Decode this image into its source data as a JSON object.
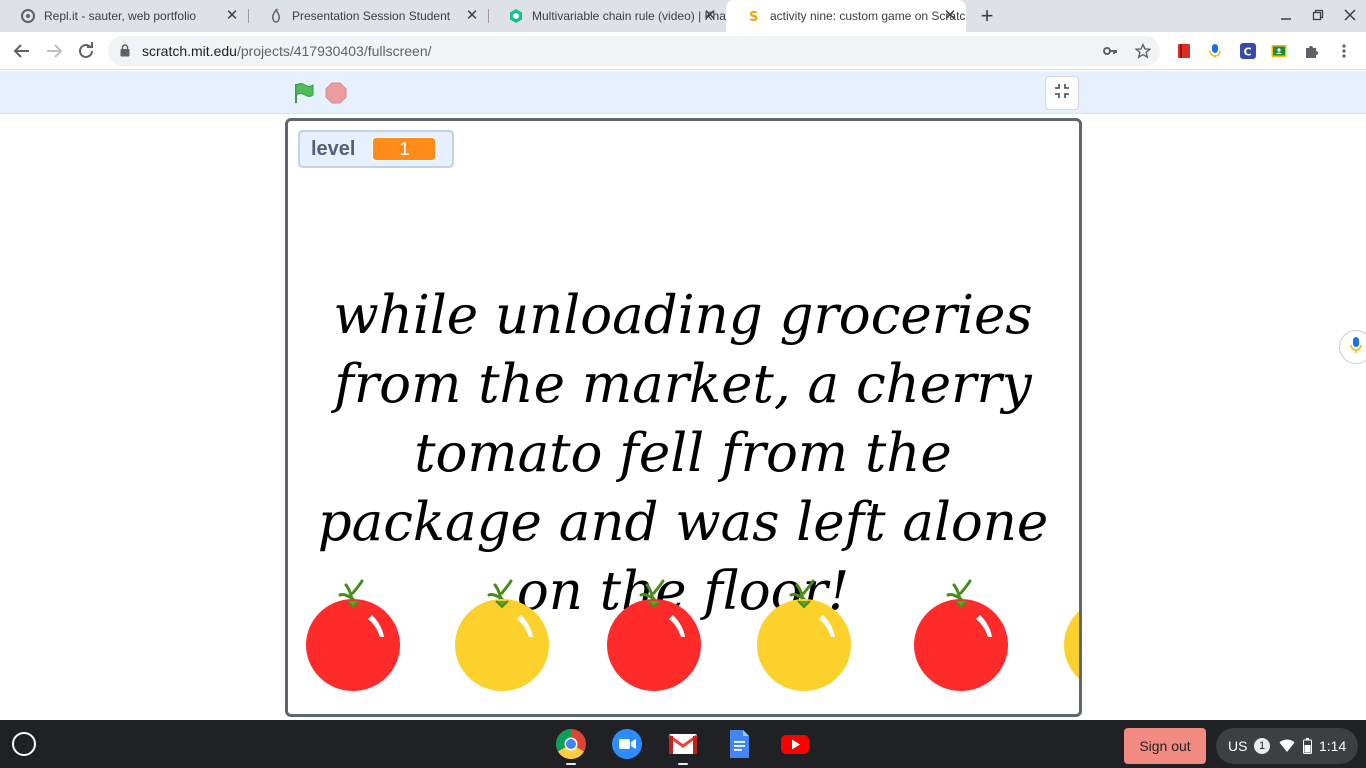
{
  "browser": {
    "tabs": [
      {
        "title": "Repl.it - sauter, web portfolio",
        "icon": "replit-icon"
      },
      {
        "title": "Presentation Session Student",
        "icon": "peardeck-icon"
      },
      {
        "title": "Multivariable chain rule (video) | Khan Academy",
        "icon": "khan-academy-icon"
      },
      {
        "title": "activity nine: custom game on Scratch",
        "icon": "scratch-icon",
        "active": true
      }
    ],
    "url_host": "scratch.mit.edu",
    "url_path": "/projects/417930403/fullscreen/"
  },
  "stage": {
    "monitor_label": "level",
    "monitor_value": "1",
    "story_text": "while unloading groceries from the market, a cherry tomato fell from the package and was left alone on the floor!",
    "fruits": [
      "red",
      "yellow",
      "red",
      "yellow",
      "red",
      "yellow"
    ]
  },
  "colors": {
    "tomato_red": "#ff2a2a",
    "tomato_yellow": "#fdd12b",
    "monitor_orange": "#ff8c1a"
  },
  "taskbar": {
    "apps": [
      "chrome-icon",
      "zoom-icon",
      "gmail-icon",
      "docs-icon",
      "youtube-icon"
    ],
    "signout_label": "Sign out",
    "ime": "US",
    "notification_count": "1",
    "time": "1:14"
  }
}
